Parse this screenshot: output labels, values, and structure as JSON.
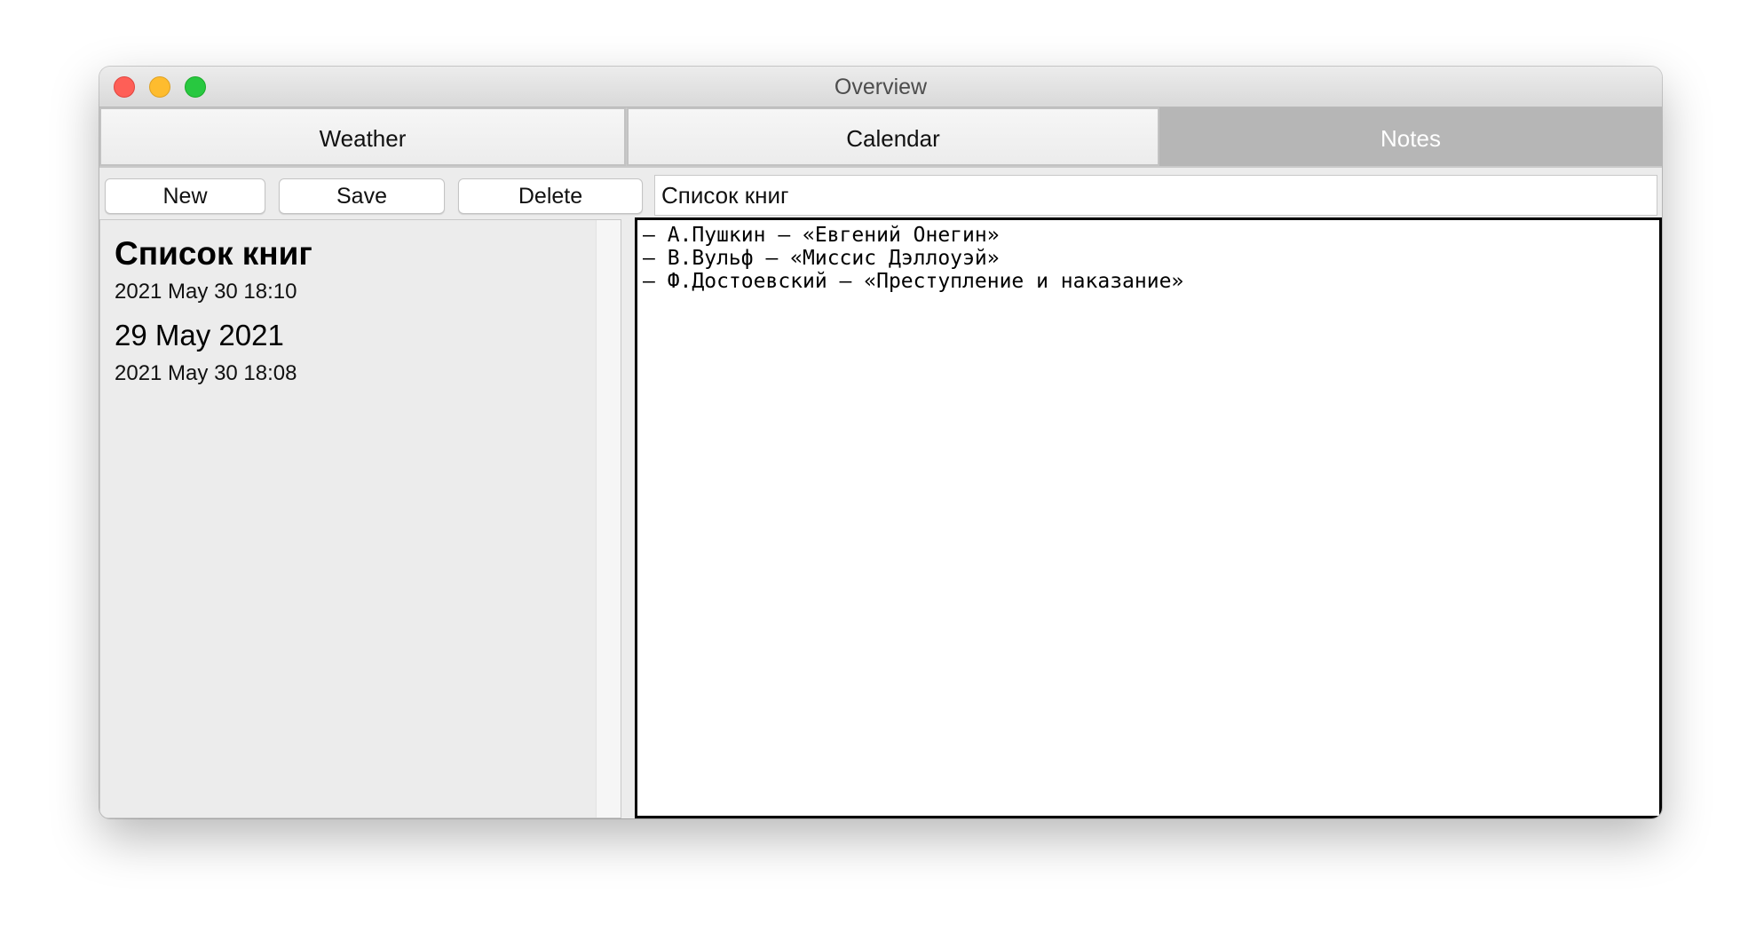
{
  "window": {
    "title": "Overview"
  },
  "tabs": [
    {
      "label": "Weather",
      "selected": false
    },
    {
      "label": "Calendar",
      "selected": false
    },
    {
      "label": "Notes",
      "selected": true
    }
  ],
  "toolbar": {
    "new_label": "New",
    "save_label": "Save",
    "delete_label": "Delete",
    "title_value": "Список книг"
  },
  "notes": [
    {
      "title": "Список книг",
      "date": "2021 May 30 18:10",
      "selected": true
    },
    {
      "title": "29 May 2021",
      "date": "2021 May 30 18:08",
      "selected": false
    }
  ],
  "editor": {
    "lines": [
      "– А.Пушкин – «Евгений Онегин»",
      "– В.Вульф – «Миссис Дэллоуэй»",
      "– Ф.Достоевский – «Преступление и наказание»"
    ]
  },
  "colors": {
    "close": "#fe5f57",
    "minimize": "#febc2e",
    "zoom": "#28c840",
    "selected_tab": "#b6b6b6"
  }
}
